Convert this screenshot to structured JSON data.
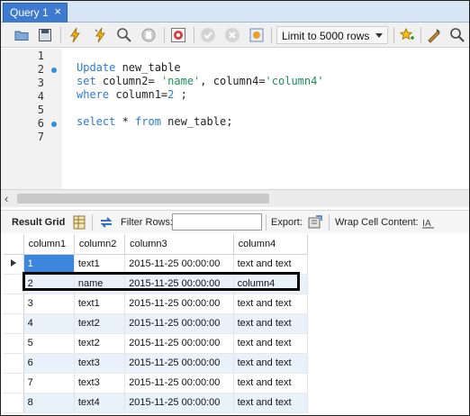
{
  "tab": {
    "title": "Query 1",
    "close": "×"
  },
  "toolbar": {
    "limit_label": "Limit to 5000 rows",
    "icons": [
      "open-folder-icon",
      "save-icon",
      "execute-icon",
      "execute-current-icon",
      "explain-icon",
      "stop-icon",
      "toggle-error-icon",
      "commit-icon",
      "rollback-icon",
      "autocommit-icon",
      "bookmark-star-icon",
      "beautify-icon",
      "find-icon"
    ]
  },
  "editor": {
    "line_numbers": [
      "1",
      "2",
      "3",
      "4",
      "5",
      "6",
      "7"
    ],
    "lines": [
      "",
      "Update new_table",
      "set column2= 'name', column4='column4'",
      "where column1=2 ;",
      "",
      "select * from new_table;",
      ""
    ]
  },
  "result_toolbar": {
    "result_grid": "Result Grid",
    "filter_rows": "Filter Rows:",
    "filter_value": "",
    "export": "Export:",
    "wrap_cell": "Wrap Cell Content:"
  },
  "grid": {
    "columns": [
      "column1",
      "column2",
      "column3",
      "column4"
    ],
    "rows": [
      [
        "1",
        "text1",
        "2015-11-25 00:00:00",
        "text and text"
      ],
      [
        "2",
        "name",
        "2015-11-25 00:00:00",
        "column4"
      ],
      [
        "3",
        "text1",
        "2015-11-25 00:00:00",
        "text and text"
      ],
      [
        "4",
        "text2",
        "2015-11-25 00:00:00",
        "text and text"
      ],
      [
        "5",
        "text2",
        "2015-11-25 00:00:00",
        "text and text"
      ],
      [
        "6",
        "text3",
        "2015-11-25 00:00:00",
        "text and text"
      ],
      [
        "7",
        "text3",
        "2015-11-25 00:00:00",
        "text and text"
      ],
      [
        "8",
        "text4",
        "2015-11-25 00:00:00",
        "text and text"
      ]
    ]
  },
  "colors": {
    "tab_active": "#3e7bd0",
    "keyword": "#2b7bd3",
    "string": "#1e8f5a",
    "selected_cell": "#3c86de",
    "alt_row": "#e9f1fb"
  }
}
